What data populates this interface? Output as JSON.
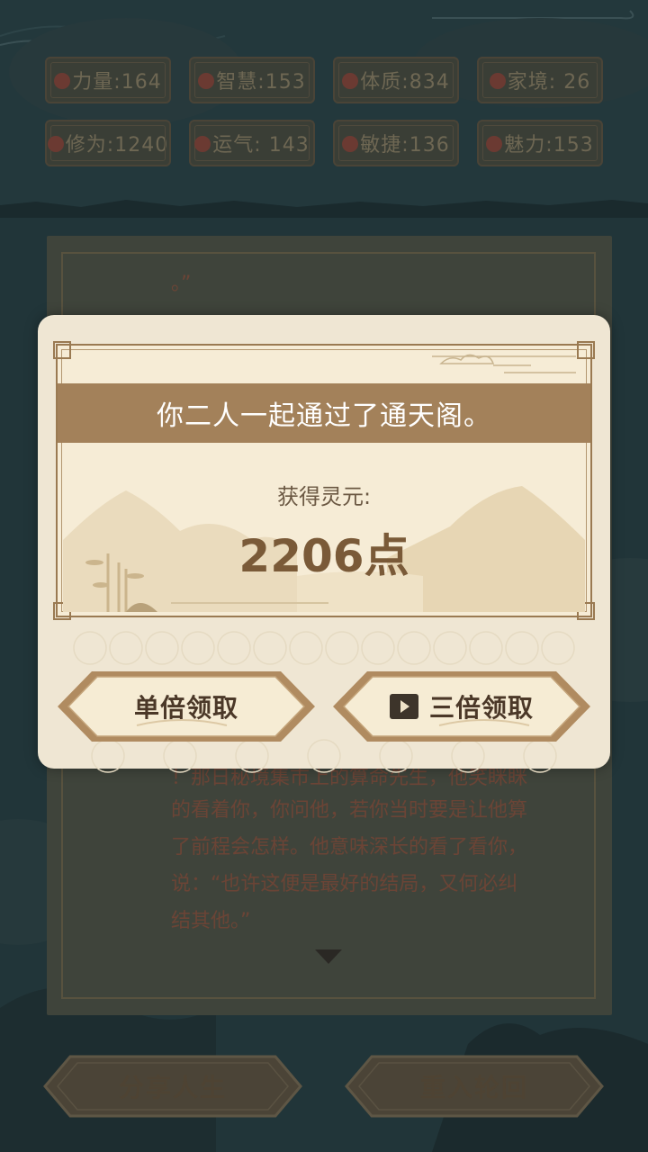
{
  "stats": [
    {
      "icon": "fist-icon",
      "label": "力量:164"
    },
    {
      "icon": "lightbulb-icon",
      "label": "智慧:153"
    },
    {
      "icon": "gear-icon",
      "label": "体质:834"
    },
    {
      "icon": "family-icon",
      "label": "家境: 26"
    },
    {
      "icon": "cloud-icon",
      "label": "修为:1240"
    },
    {
      "icon": "square-icon",
      "label": "运气: 143"
    },
    {
      "icon": "lightning-icon",
      "label": "敏捷:136"
    },
    {
      "icon": "heart-icon",
      "label": "魅力:153"
    }
  ],
  "story": {
    "fragment_top": "。”",
    "lines": [
      "！那日秘境集市上的算命先生，他笑眯眯",
      "的看着你，你问他，若你当时要是让他算",
      "了前程会怎样。他意味深长的看了看你，",
      "说：“也许这便是最好的结局，又何必纠",
      "结其他。”"
    ]
  },
  "modal": {
    "title": "你二人一起通过了通天阁。",
    "reward_label": "获得灵元:",
    "reward_amount": "2206点",
    "single_button": "单倍领取",
    "triple_button": "三倍领取"
  },
  "bottom": {
    "share_button": "分享人生",
    "restart_button": "重入轮回"
  }
}
